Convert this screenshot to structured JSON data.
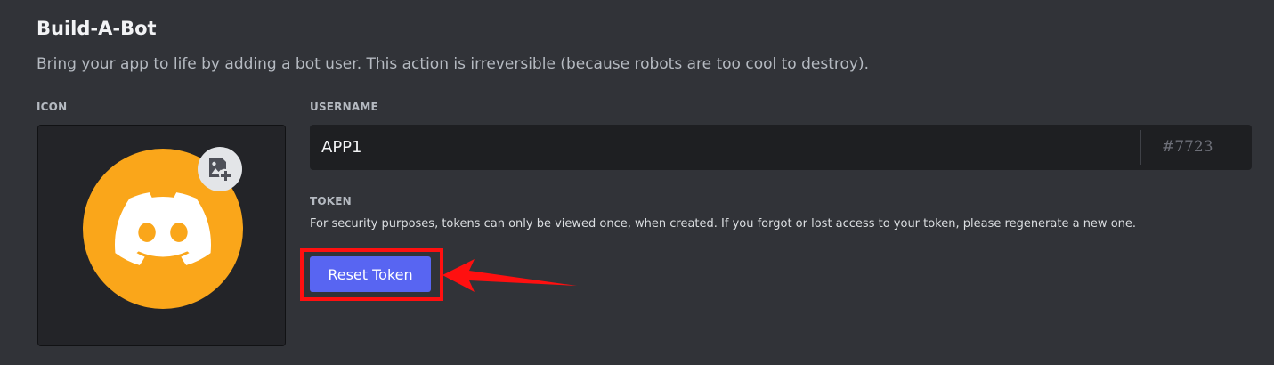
{
  "header": {
    "title": "Build-A-Bot",
    "subtitle": "Bring your app to life by adding a bot user. This action is irreversible (because robots are too cool to destroy)."
  },
  "icon_section": {
    "label": "ICON",
    "avatar_icon": "discord-logo-icon",
    "avatar_color": "#faa61a",
    "upload_icon": "image-add-icon"
  },
  "username_section": {
    "label": "USERNAME",
    "value": "APP1",
    "discriminator": "#7723"
  },
  "token_section": {
    "label": "TOKEN",
    "description": "For security purposes, tokens can only be viewed once, when created. If you forgot or lost access to your token, please regenerate a new one.",
    "reset_button_label": "Reset Token",
    "button_color": "#5865f2"
  },
  "annotation": {
    "highlight_color": "#ff1010",
    "arrow_icon": "red-arrow-pointer"
  }
}
